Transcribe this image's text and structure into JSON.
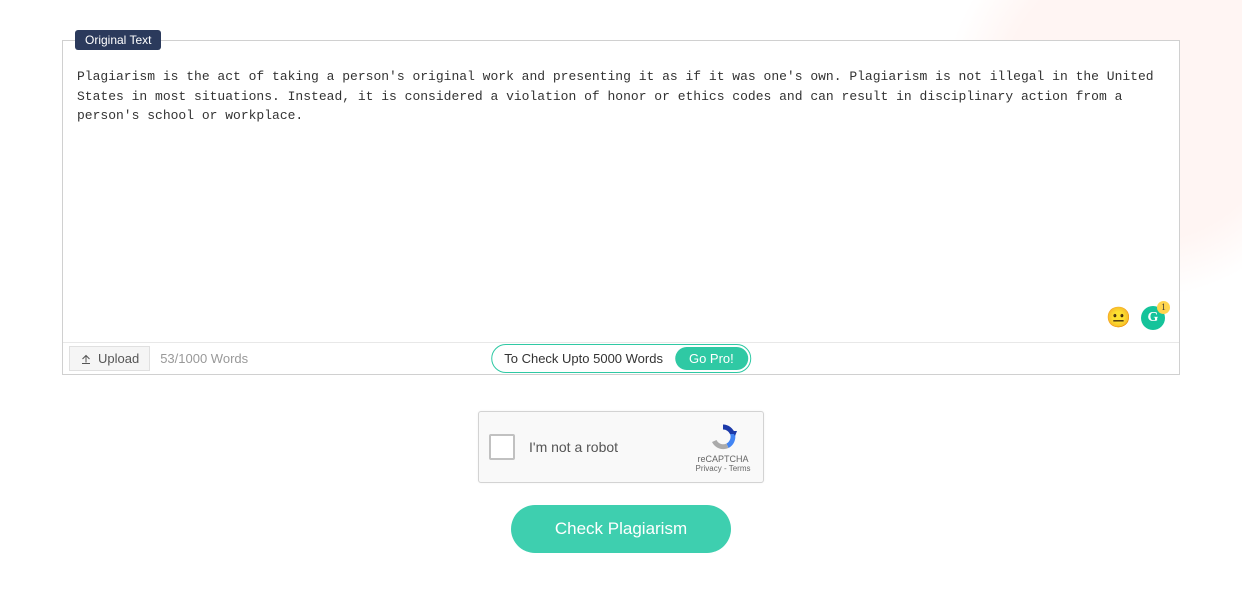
{
  "editor": {
    "badge": "Original Text",
    "content": "Plagiarism is the act of taking a person's original work and presenting it as if it was one's own. Plagiarism is not illegal in the United States in most situations. Instead, it is considered a violation of honor or ethics codes and can result in disciplinary action from a person's school or workplace.",
    "upload_label": "Upload",
    "word_count": "53/1000 Words",
    "pro_text": "To Check Upto 5000 Words",
    "go_pro_label": "Go Pro!",
    "grammarly_count": "1"
  },
  "captcha": {
    "label": "I'm not a robot",
    "brand": "reCAPTCHA",
    "privacy": "Privacy",
    "terms": "Terms"
  },
  "actions": {
    "check_label": "Check Plagiarism"
  }
}
